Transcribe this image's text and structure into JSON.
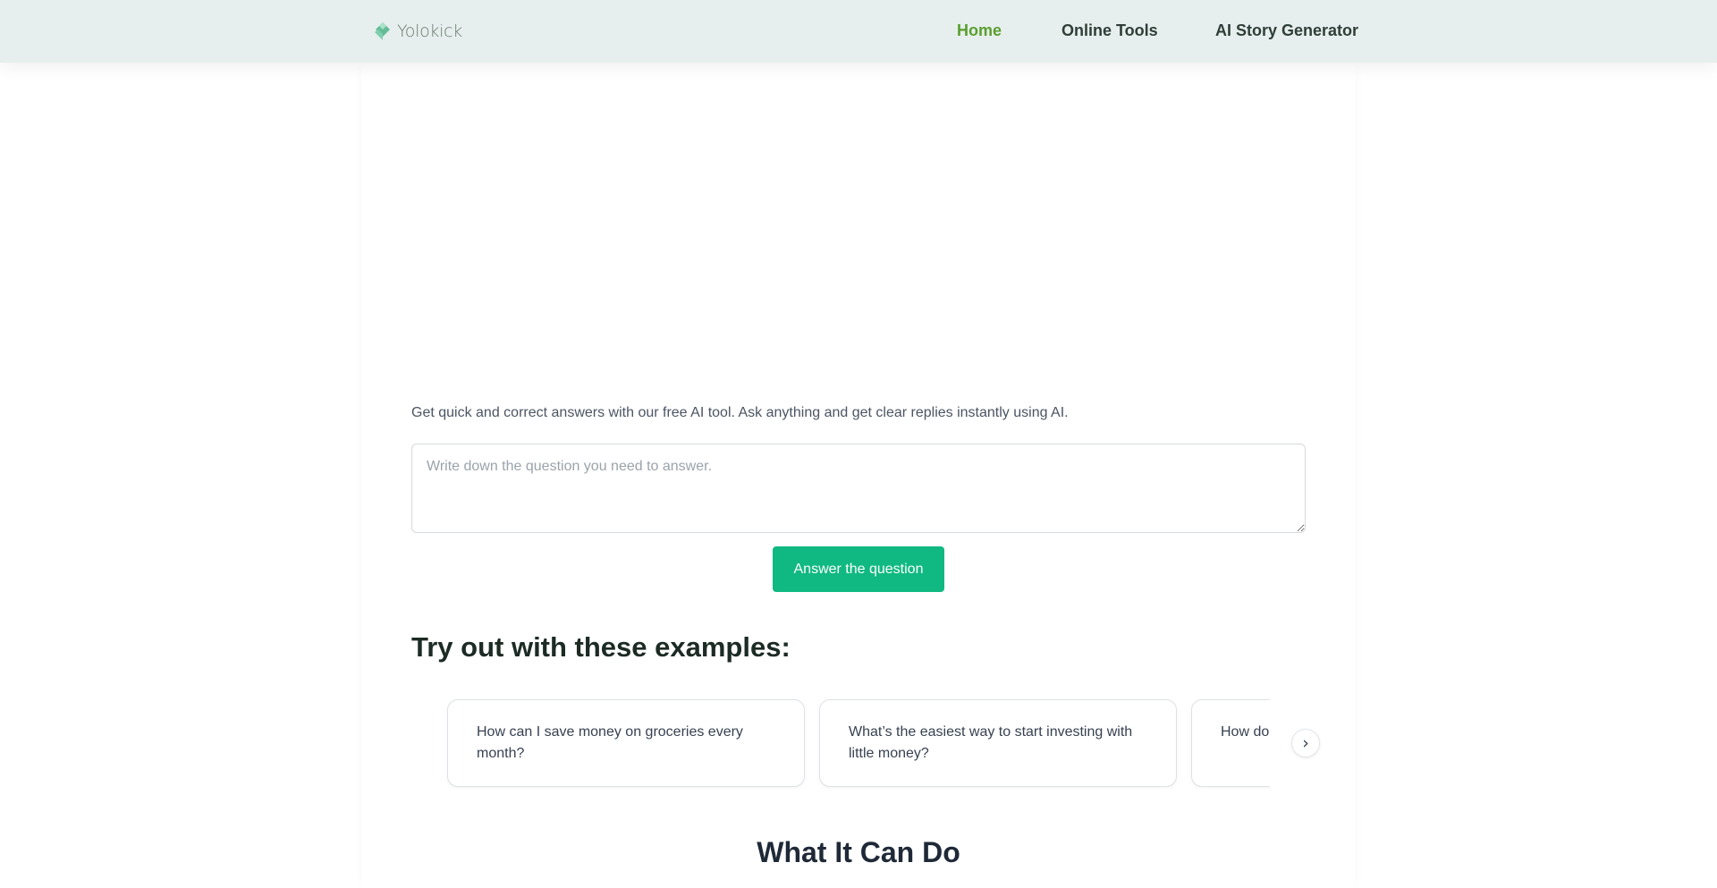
{
  "header": {
    "logo_text": "Yolokick",
    "nav": [
      {
        "label": "Home",
        "active": true
      },
      {
        "label": "Online Tools",
        "active": false
      },
      {
        "label": "AI Story Generator",
        "active": false
      }
    ]
  },
  "main": {
    "intro": "Get quick and correct answers with our free AI tool. Ask anything and get clear replies instantly using AI.",
    "question_placeholder": "Write down the question you need to answer.",
    "question_value": "",
    "answer_button": "Answer the question",
    "examples_title": "Try out with these examples:",
    "examples": [
      "How can I save money on groceries every month?",
      "What’s the easiest way to start investing with little money?",
      "How do I avoid phishing scams?"
    ],
    "carousel_next_glyph": "›",
    "section_title": "What It Can Do"
  },
  "colors": {
    "header_bg": "#e6efed",
    "nav_active": "#5a9e2f",
    "nav_text": "#2f3e38",
    "button_bg": "#10b981"
  },
  "icons": {
    "logo": "diamond-logo-icon",
    "carousel_next": "chevron-right-icon"
  }
}
